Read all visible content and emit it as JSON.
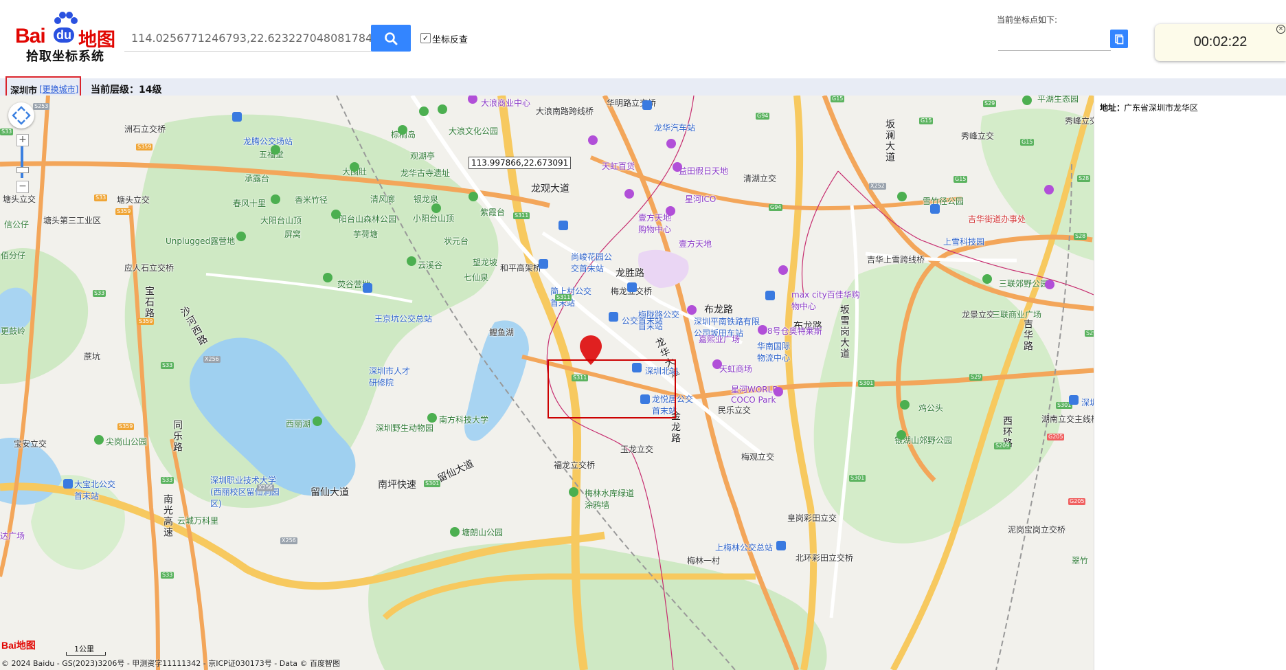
{
  "header": {
    "logo": {
      "brand": "Bai",
      "du": "du",
      "ditu": "地图",
      "subtitle": "拾取坐标系统"
    },
    "search": {
      "value": "114.0256771246793,22.623227048081784"
    },
    "reverse_label": "坐标反查",
    "current_label": "当前坐标点如下:",
    "current_value": "",
    "timer": "00:02:22",
    "accent_color": "#3385ff"
  },
  "infobar": {
    "city": "深圳市",
    "change_city": "[更换城市]",
    "zoom_level": "当前层级：14级"
  },
  "map": {
    "tooltip_coord": "113.997866,22.673091",
    "scale": "1公里",
    "copyright": "© 2024 Baidu - GS(2023)3206号 - 甲测资字11111342 - 京ICP证030173号 - Data © 百度智图",
    "logo": "Bai地图",
    "labels": {
      "l1": "大浪商业中心",
      "l2": "华明路立交桥",
      "l3": "大浪南路跨线桥",
      "l4": "棕榈岛",
      "l5": "大浪文化公园",
      "l6": "龙华汽车站",
      "l7": "洲石立交桥",
      "l8": "龙腾公交场站",
      "l9": "观湖亭",
      "l10": "五福堂",
      "l11": "大围肚",
      "l12": "龙华古寺遗址",
      "l13": "天虹百货",
      "l14": "益田假日天地",
      "l15": "清湖立交",
      "l16": "龙观大道",
      "l17": "承露台",
      "l18": "银龙泉",
      "l19": "星河ICO",
      "l20": "春风十里",
      "l21": "香米竹径",
      "l22": "清风廊",
      "l23": "紫霞台",
      "l24": "雪竹径公园",
      "l25": "塘头立交",
      "l26": "塘头立交",
      "l27": "塘头第三工业区",
      "l28": "大阳台山顶",
      "l29": "阳台山森林公园",
      "l30": "小阳台山顶",
      "l31": "壹方天地购物中心",
      "l32": "吉华街道办事处",
      "l33": "屏窝",
      "l34": "芋荷塘",
      "l35": "上雪科技园",
      "l36": "Unplugged露营地",
      "l37": "状元台",
      "l38": "壹方天地",
      "l39": "佰分仔",
      "l40": "云溪谷",
      "l41": "望龙坡",
      "l42": "尚峻花园公交首末站",
      "l43": "吉华上雪跨线桥",
      "l44": "应人石立交桥",
      "l45": "和平高架桥",
      "l46": "七仙泉",
      "l47": "龙胜路",
      "l48": "荧谷营地",
      "l49": "简上村公交首末站",
      "l50": "梅龙立交桥",
      "l51": "布龙路",
      "l52": "max city百佳华购物中心",
      "l53": "三联郊野公园",
      "l54": "宝石路",
      "l55": "王京坑公交总站",
      "l56": "梅陇路公交首末站",
      "l57": "深圳平南铁路有限公司坂田车站",
      "l58": "布龙路",
      "l59": "龙景立交",
      "l60": "三联商业广场",
      "l61": "沙河西路",
      "l62": "公交首末站",
      "l63": "嘉熙业广场",
      "l64": "坂雪岗大道",
      "l65": "吉华路",
      "l66": "鲤鱼湖",
      "l67": "8号仓奥特莱斯",
      "l68": "更鼓岭",
      "l69": "龙华大道",
      "l70": "华南国际物流中心",
      "l71": "蔗坑",
      "l72": "深圳市人才研修院",
      "l73": "深圳北站",
      "l74": "天虹商场",
      "l75": "星河WORLD COCO Park",
      "l76": "龙悦居公交首末站",
      "l77": "民乐立交",
      "l78": "鸡公头",
      "l79": "深圳",
      "l80": "西丽湖",
      "l81": "深圳野生动物园",
      "l82": "南方科技大学",
      "l83": "湖南立交主线桥",
      "l84": "金龙路",
      "l85": "同乐路",
      "l86": "宝安立交",
      "l87": "尖岗山公园",
      "l88": "银湖山郊野公园",
      "l89": "西环路",
      "l90": "玉龙立交",
      "l91": "梅观立交",
      "l92": "福龙立交桥",
      "l93": "留仙大道",
      "l94": "南坪快速",
      "l95": "留仙大道",
      "l96": "大宝北公交首末站",
      "l97": "深圳职业技术大学(西丽校区留仙洞园区)",
      "l98": "南光高速",
      "l99": "梅林水库绿道涂鸦墙",
      "l100": "皇岗彩田立交",
      "l101": "云城万科里",
      "l102": "塘朗山公园",
      "l103": "泥岗宝岗立交桥",
      "l104": "上梅林公交总站",
      "l105": "北环彩田立交桥",
      "l106": "梅林一村",
      "l107": "翠竹",
      "l108": "信公仔",
      "l109": "秀峰立交",
      "l110": "秀峰立交",
      "l111": "坂澜大道",
      "l112": "平湖生态园",
      "l113": "达广场"
    },
    "shields": {
      "s1": "S253",
      "s2": "S33",
      "s3": "S359",
      "s4": "S359",
      "s5": "S33",
      "s6": "S359",
      "s7": "S33",
      "s8": "X256",
      "s9": "S33",
      "s10": "S359",
      "s11": "S33",
      "s12": "X256",
      "s13": "S301",
      "s14": "S311",
      "s15": "S311",
      "s16": "S311",
      "s17": "G94",
      "s18": "G94",
      "s19": "G15",
      "s20": "G15",
      "s21": "S29",
      "s22": "S28",
      "s23": "S301",
      "s24": "S209",
      "s25": "X252",
      "s26": "G205",
      "s27": "G205",
      "s28": "S29",
      "s29": "G15",
      "s30": "S29",
      "s31": "S301",
      "s32": "X256",
      "s33": "S33",
      "s34": "S301",
      "s35": "S28",
      "s36": "G15"
    }
  },
  "sidepanel": {
    "address_key": "地址：",
    "address_value": "广东省深圳市龙华区"
  }
}
